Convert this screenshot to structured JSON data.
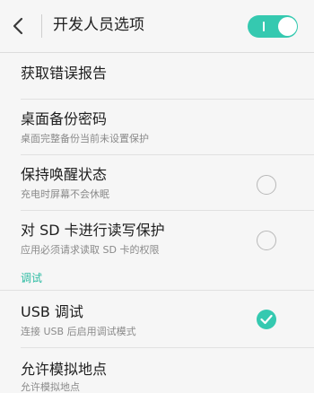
{
  "header": {
    "title": "开发人员选项",
    "master_toggle_on": true
  },
  "accent_color": "#35c9b0",
  "section_color": "#2cbba2",
  "icons": [
    "back-chevron-icon",
    "check-icon"
  ],
  "rows": [
    {
      "title": "获取错误报告"
    },
    {
      "title": "桌面备份密码",
      "summary": "桌面完整备份当前未设置保护"
    },
    {
      "title": "保持唤醒状态",
      "summary": "充电时屏幕不会休眠",
      "checked": false
    },
    {
      "title": "对 SD 卡进行读写保护",
      "summary": "应用必须请求读取 SD 卡的权限",
      "checked": false
    }
  ],
  "section": {
    "label": "调试",
    "rows": [
      {
        "title": "USB 调试",
        "summary": "连接 USB 后启用调试模式",
        "checked": true
      },
      {
        "title": "允许模拟地点",
        "summary": "允许模拟地点"
      }
    ]
  }
}
